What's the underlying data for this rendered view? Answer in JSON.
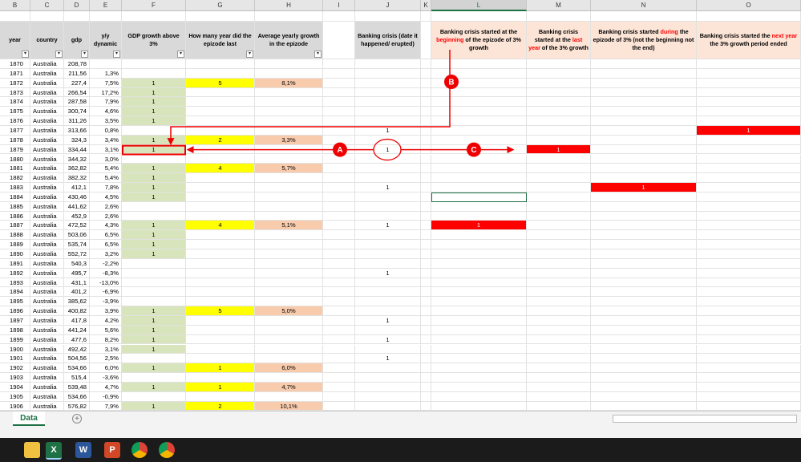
{
  "columns": [
    "B",
    "C",
    "D",
    "E",
    "F",
    "G",
    "H",
    "I",
    "J",
    "K",
    "L",
    "M",
    "N",
    "O"
  ],
  "headers": {
    "year": "year",
    "country": "country",
    "gdp": "gdp",
    "yy": "y/y dynamic",
    "F": "GDP growth above 3%",
    "G": "How many year did the epizode last",
    "H": "Average yearly growth in the epizode",
    "J": "Banking crisis (date it happened/ erupted)",
    "L": {
      "a": "Banking crisis started at the ",
      "red": "beginning",
      "b": " of the epizode of 3% growth"
    },
    "M": {
      "a": "Banking crisis started at the ",
      "red": "last year",
      "b": " of the 3% growth"
    },
    "N": {
      "a": "Banking crisis started ",
      "red": "during",
      "b": " the epizode of 3% (not the beginning not the end)"
    },
    "O": {
      "a": "Banking crisis started the ",
      "red": "next year",
      "b": " the 3% growth period ended"
    }
  },
  "rows": [
    {
      "year": "1870",
      "country": "Australia",
      "gdp": "208,78",
      "yy": "",
      "F": "",
      "G": "",
      "H": "",
      "J": "",
      "L": "",
      "M": "",
      "N": "",
      "O": ""
    },
    {
      "year": "1871",
      "country": "Australia",
      "gdp": "211,56",
      "yy": "1,3%",
      "F": "",
      "G": "",
      "H": "",
      "J": "",
      "L": "",
      "M": "",
      "N": "",
      "O": ""
    },
    {
      "year": "1872",
      "country": "Australia",
      "gdp": "227,4",
      "yy": "7,5%",
      "F": "1",
      "G": "5",
      "H": "8,1%",
      "J": "",
      "L": "",
      "M": "",
      "N": "",
      "O": ""
    },
    {
      "year": "1873",
      "country": "Australia",
      "gdp": "266,54",
      "yy": "17,2%",
      "F": "1",
      "G": "",
      "H": "",
      "J": "",
      "L": "",
      "M": "",
      "N": "",
      "O": ""
    },
    {
      "year": "1874",
      "country": "Australia",
      "gdp": "287,58",
      "yy": "7,9%",
      "F": "1",
      "G": "",
      "H": "",
      "J": "",
      "L": "",
      "M": "",
      "N": "",
      "O": ""
    },
    {
      "year": "1875",
      "country": "Australia",
      "gdp": "300,74",
      "yy": "4,6%",
      "F": "1",
      "G": "",
      "H": "",
      "J": "",
      "L": "",
      "M": "",
      "N": "",
      "O": ""
    },
    {
      "year": "1876",
      "country": "Australia",
      "gdp": "311,26",
      "yy": "3,5%",
      "F": "1",
      "G": "",
      "H": "",
      "J": "",
      "L": "",
      "M": "",
      "N": "",
      "O": ""
    },
    {
      "year": "1877",
      "country": "Australia",
      "gdp": "313,66",
      "yy": "0,8%",
      "F": "",
      "G": "",
      "H": "",
      "J": "1",
      "L": "",
      "M": "",
      "N": "",
      "O": "1"
    },
    {
      "year": "1878",
      "country": "Australia",
      "gdp": "324,3",
      "yy": "3,4%",
      "F": "1",
      "G": "2",
      "H": "3,3%",
      "J": "",
      "L": "",
      "M": "",
      "N": "",
      "O": ""
    },
    {
      "year": "1879",
      "country": "Australia",
      "gdp": "334,44",
      "yy": "3,1%",
      "F": "1",
      "G": "",
      "H": "",
      "J": "1",
      "L": "",
      "M": "1",
      "N": "",
      "O": ""
    },
    {
      "year": "1880",
      "country": "Australia",
      "gdp": "344,32",
      "yy": "3,0%",
      "F": "",
      "G": "",
      "H": "",
      "J": "",
      "L": "",
      "M": "",
      "N": "",
      "O": ""
    },
    {
      "year": "1881",
      "country": "Australia",
      "gdp": "362,82",
      "yy": "5,4%",
      "F": "1",
      "G": "4",
      "H": "5,7%",
      "J": "",
      "L": "",
      "M": "",
      "N": "",
      "O": ""
    },
    {
      "year": "1882",
      "country": "Australia",
      "gdp": "382,32",
      "yy": "5,4%",
      "F": "1",
      "G": "",
      "H": "",
      "J": "",
      "L": "",
      "M": "",
      "N": "",
      "O": ""
    },
    {
      "year": "1883",
      "country": "Australia",
      "gdp": "412,1",
      "yy": "7,8%",
      "F": "1",
      "G": "",
      "H": "",
      "J": "1",
      "L": "",
      "M": "",
      "N": "1",
      "O": ""
    },
    {
      "year": "1884",
      "country": "Australia",
      "gdp": "430,46",
      "yy": "4,5%",
      "F": "1",
      "G": "",
      "H": "",
      "J": "",
      "L": "",
      "M": "",
      "N": "",
      "O": ""
    },
    {
      "year": "1885",
      "country": "Australia",
      "gdp": "441,62",
      "yy": "2,6%",
      "F": "",
      "G": "",
      "H": "",
      "J": "",
      "L": "",
      "M": "",
      "N": "",
      "O": ""
    },
    {
      "year": "1886",
      "country": "Australia",
      "gdp": "452,9",
      "yy": "2,6%",
      "F": "",
      "G": "",
      "H": "",
      "J": "",
      "L": "",
      "M": "",
      "N": "",
      "O": ""
    },
    {
      "year": "1887",
      "country": "Australia",
      "gdp": "472,52",
      "yy": "4,3%",
      "F": "1",
      "G": "4",
      "H": "5,1%",
      "J": "1",
      "L": "1",
      "M": "",
      "N": "",
      "O": ""
    },
    {
      "year": "1888",
      "country": "Australia",
      "gdp": "503,06",
      "yy": "6,5%",
      "F": "1",
      "G": "",
      "H": "",
      "J": "",
      "L": "",
      "M": "",
      "N": "",
      "O": ""
    },
    {
      "year": "1889",
      "country": "Australia",
      "gdp": "535,74",
      "yy": "6,5%",
      "F": "1",
      "G": "",
      "H": "",
      "J": "",
      "L": "",
      "M": "",
      "N": "",
      "O": ""
    },
    {
      "year": "1890",
      "country": "Australia",
      "gdp": "552,72",
      "yy": "3,2%",
      "F": "1",
      "G": "",
      "H": "",
      "J": "",
      "L": "",
      "M": "",
      "N": "",
      "O": ""
    },
    {
      "year": "1891",
      "country": "Australia",
      "gdp": "540,3",
      "yy": "-2,2%",
      "F": "",
      "G": "",
      "H": "",
      "J": "",
      "L": "",
      "M": "",
      "N": "",
      "O": ""
    },
    {
      "year": "1892",
      "country": "Australia",
      "gdp": "495,7",
      "yy": "-8,3%",
      "F": "",
      "G": "",
      "H": "",
      "J": "1",
      "L": "",
      "M": "",
      "N": "",
      "O": ""
    },
    {
      "year": "1893",
      "country": "Australia",
      "gdp": "431,1",
      "yy": "-13,0%",
      "F": "",
      "G": "",
      "H": "",
      "J": "",
      "L": "",
      "M": "",
      "N": "",
      "O": ""
    },
    {
      "year": "1894",
      "country": "Australia",
      "gdp": "401,2",
      "yy": "-6,9%",
      "F": "",
      "G": "",
      "H": "",
      "J": "",
      "L": "",
      "M": "",
      "N": "",
      "O": ""
    },
    {
      "year": "1895",
      "country": "Australia",
      "gdp": "385,62",
      "yy": "-3,9%",
      "F": "",
      "G": "",
      "H": "",
      "J": "",
      "L": "",
      "M": "",
      "N": "",
      "O": ""
    },
    {
      "year": "1896",
      "country": "Australia",
      "gdp": "400,82",
      "yy": "3,9%",
      "F": "1",
      "G": "5",
      "H": "5,0%",
      "J": "",
      "L": "",
      "M": "",
      "N": "",
      "O": ""
    },
    {
      "year": "1897",
      "country": "Australia",
      "gdp": "417,8",
      "yy": "4,2%",
      "F": "1",
      "G": "",
      "H": "",
      "J": "1",
      "L": "",
      "M": "",
      "N": "",
      "O": ""
    },
    {
      "year": "1898",
      "country": "Australia",
      "gdp": "441,24",
      "yy": "5,6%",
      "F": "1",
      "G": "",
      "H": "",
      "J": "",
      "L": "",
      "M": "",
      "N": "",
      "O": ""
    },
    {
      "year": "1899",
      "country": "Australia",
      "gdp": "477,6",
      "yy": "8,2%",
      "F": "1",
      "G": "",
      "H": "",
      "J": "1",
      "L": "",
      "M": "",
      "N": "",
      "O": ""
    },
    {
      "year": "1900",
      "country": "Australia",
      "gdp": "492,42",
      "yy": "3,1%",
      "F": "1",
      "G": "",
      "H": "",
      "J": "",
      "L": "",
      "M": "",
      "N": "",
      "O": ""
    },
    {
      "year": "1901",
      "country": "Australia",
      "gdp": "504,56",
      "yy": "2,5%",
      "F": "",
      "G": "",
      "H": "",
      "J": "1",
      "L": "",
      "M": "",
      "N": "",
      "O": ""
    },
    {
      "year": "1902",
      "country": "Australia",
      "gdp": "534,66",
      "yy": "6,0%",
      "F": "1",
      "G": "1",
      "H": "6,0%",
      "J": "",
      "L": "",
      "M": "",
      "N": "",
      "O": ""
    },
    {
      "year": "1903",
      "country": "Australia",
      "gdp": "515,4",
      "yy": "-3,6%",
      "F": "",
      "G": "",
      "H": "",
      "J": "",
      "L": "",
      "M": "",
      "N": "",
      "O": ""
    },
    {
      "year": "1904",
      "country": "Australia",
      "gdp": "539,48",
      "yy": "4,7%",
      "F": "1",
      "G": "1",
      "H": "4,7%",
      "J": "",
      "L": "",
      "M": "",
      "N": "",
      "O": ""
    },
    {
      "year": "1905",
      "country": "Australia",
      "gdp": "534,66",
      "yy": "-0,9%",
      "F": "",
      "G": "",
      "H": "",
      "J": "",
      "L": "",
      "M": "",
      "N": "",
      "O": ""
    },
    {
      "year": "1906",
      "country": "Australia",
      "gdp": "576,82",
      "yy": "7,9%",
      "F": "1",
      "G": "2",
      "H": "10,1%",
      "J": "",
      "L": "",
      "M": "",
      "N": "",
      "O": ""
    }
  ],
  "annotations": {
    "a": "A",
    "b": "B",
    "c": "C"
  },
  "sheet_tab": "Data",
  "add_sheet": "+",
  "taskbar_apps": [
    {
      "name": "file-explorer",
      "label": "",
      "color": "#f0c040"
    },
    {
      "name": "excel",
      "label": "X",
      "color": "#1e7145"
    },
    {
      "name": "word",
      "label": "W",
      "color": "#2b579a"
    },
    {
      "name": "powerpoint",
      "label": "P",
      "color": "#d24726"
    },
    {
      "name": "chrome",
      "label": "",
      "color": "#dd4b39"
    },
    {
      "name": "chrome-2",
      "label": "",
      "color": "#dd4b39"
    }
  ],
  "colors": {
    "green": "#d8e4bc",
    "yellow": "#ffff00",
    "orange": "#f8cbad",
    "red": "#ff0000",
    "peach": "#fce4d6",
    "excel_green": "#1e7145"
  }
}
